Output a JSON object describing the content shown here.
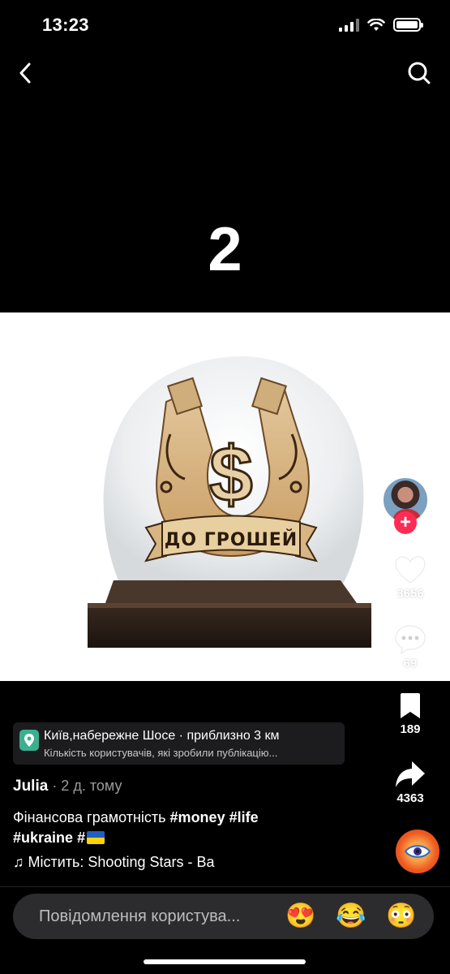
{
  "status": {
    "time": "13:23"
  },
  "post": {
    "number": "2"
  },
  "product": {
    "banner_text": "ДО ГРОШЕЙ",
    "symbol": "$"
  },
  "rail": {
    "likes": "3656",
    "comments": "69",
    "saves": "189",
    "shares": "4363"
  },
  "location": {
    "title": "Київ,набережне Шосе · приблизно 3 км",
    "subtitle": "Кількість користувачів, які зробили публікацію..."
  },
  "author": {
    "name": "Julia",
    "meta": " · 2 д. тому"
  },
  "caption": {
    "text": "Фінансова грамотність ",
    "tags": [
      "#money",
      "#life",
      "#ukraine",
      "#"
    ]
  },
  "music": {
    "label": "♫ Містить: Shooting Stars - Ba"
  },
  "comment": {
    "placeholder": "Повідомлення користува...",
    "emojis": [
      "😍",
      "😂",
      "😳"
    ]
  },
  "colors": {
    "accent": "#fe2c55",
    "location_pin": "#3ab08e",
    "flag_blue": "#1f5fbf",
    "flag_yellow": "#ffd200"
  }
}
